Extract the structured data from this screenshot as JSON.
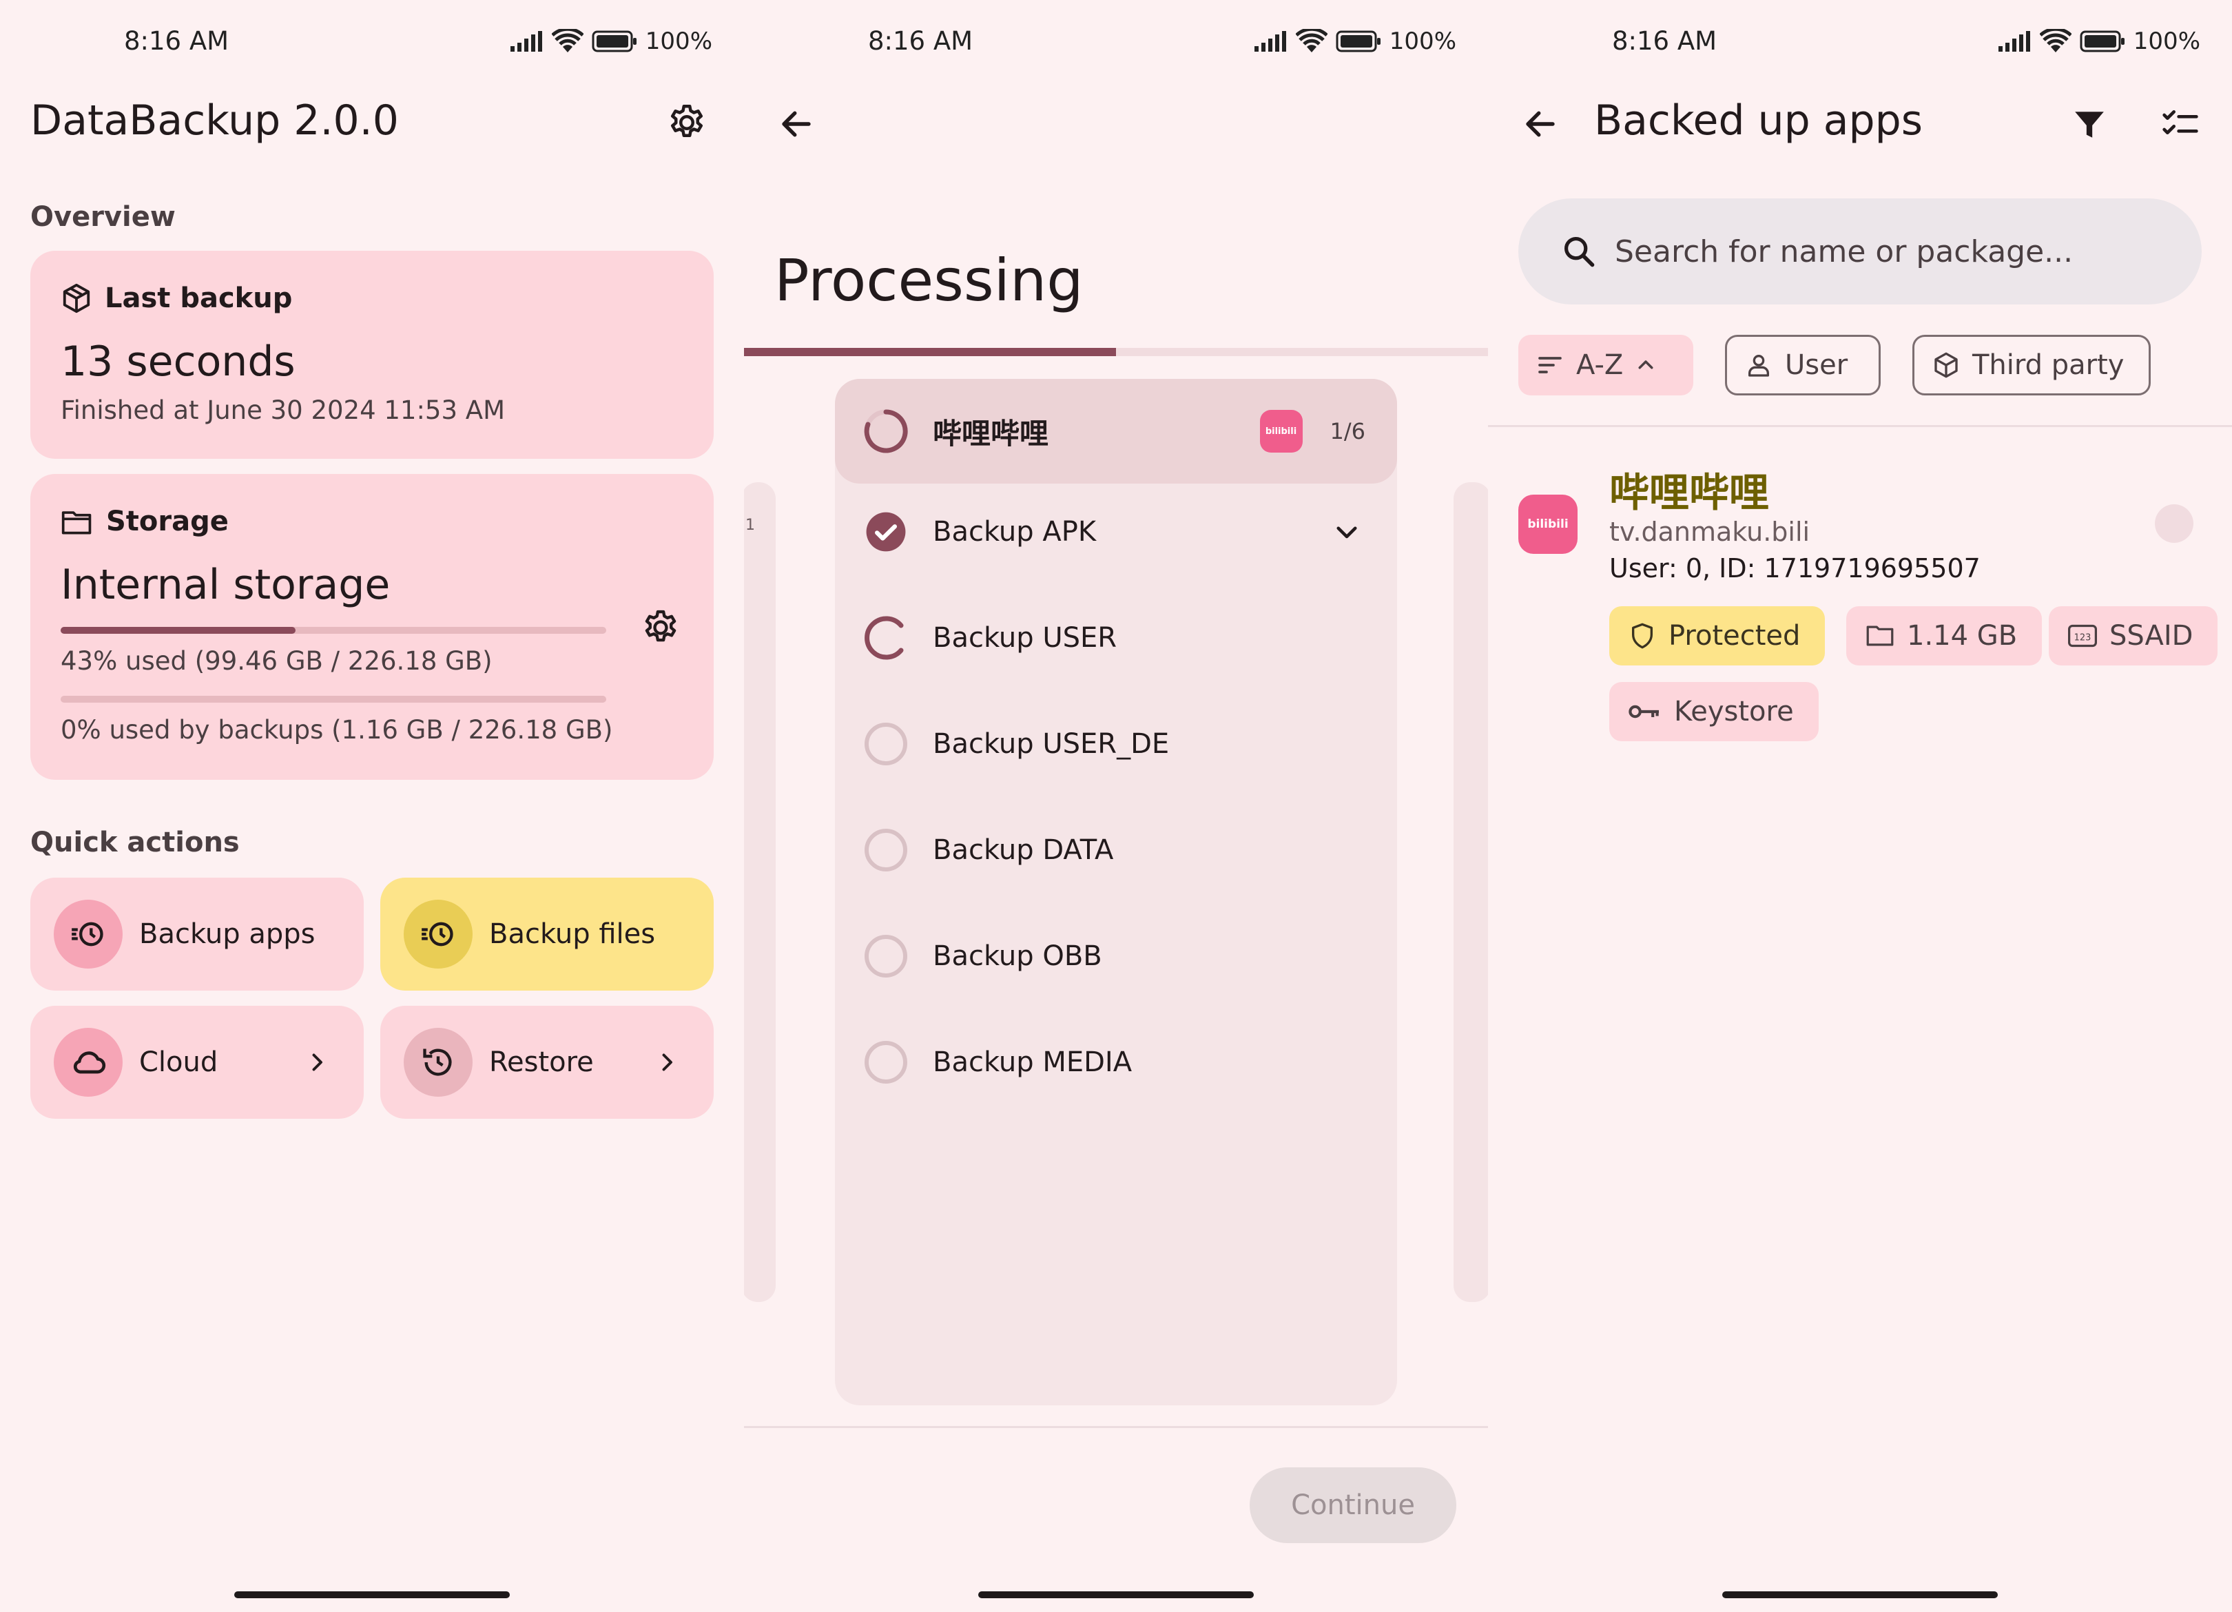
{
  "status_bar": {
    "time": "8:16 AM",
    "battery": "100%"
  },
  "home": {
    "app_title": "DataBackup 2.0.0",
    "overview_label": "Overview",
    "last_backup": {
      "label": "Last backup",
      "value": "13 seconds",
      "finished": "Finished at June 30 2024 11:53 AM"
    },
    "storage": {
      "label": "Storage",
      "name": "Internal storage",
      "used_text": "43% used (99.46 GB / 226.18 GB)",
      "used_fraction": 0.43,
      "backup_text": "0% used by backups (1.16 GB / 226.18 GB)",
      "backup_fraction": 0.0
    },
    "quick_actions_label": "Quick actions",
    "quick_actions": [
      {
        "label": "Backup apps",
        "icon": "backup-history-icon"
      },
      {
        "label": "Backup files",
        "icon": "backup-history-icon"
      },
      {
        "label": "Cloud",
        "icon": "cloud-icon"
      },
      {
        "label": "Restore",
        "icon": "restore-icon"
      }
    ]
  },
  "processing": {
    "title": "Processing",
    "progress_fraction": 0.5,
    "side_left_label": "1",
    "app_name": "哔哩哔哩",
    "app_icon_text": "bilibili",
    "count": "1/6",
    "tasks": [
      {
        "label": "Backup APK",
        "state": "done"
      },
      {
        "label": "Backup USER",
        "state": "running"
      },
      {
        "label": "Backup USER_DE",
        "state": "pending"
      },
      {
        "label": "Backup DATA",
        "state": "pending"
      },
      {
        "label": "Backup OBB",
        "state": "pending"
      },
      {
        "label": "Backup MEDIA",
        "state": "pending"
      }
    ],
    "continue_label": "Continue"
  },
  "backed_up": {
    "title": "Backed up apps",
    "search_placeholder": "Search for name or package...",
    "chips": {
      "sort": "A-Z",
      "user": "User",
      "third_party": "Third party"
    },
    "app": {
      "icon_text": "bilibili",
      "name": "哔哩哔哩",
      "package": "tv.danmaku.bili",
      "ids": "User: 0, ID: 1719719695507",
      "tags": {
        "protected": "Protected",
        "size": "1.14 GB",
        "ssaid": "SSAID",
        "keystore": "Keystore"
      }
    }
  },
  "colors": {
    "background": "#fdf1f2",
    "primary": "#8b4a5a",
    "card_pink": "#fdd6dc",
    "accent_yellow": "#fde48a",
    "app_name_olive": "#6d5f00",
    "bilibili_pink": "#f05d8c"
  }
}
